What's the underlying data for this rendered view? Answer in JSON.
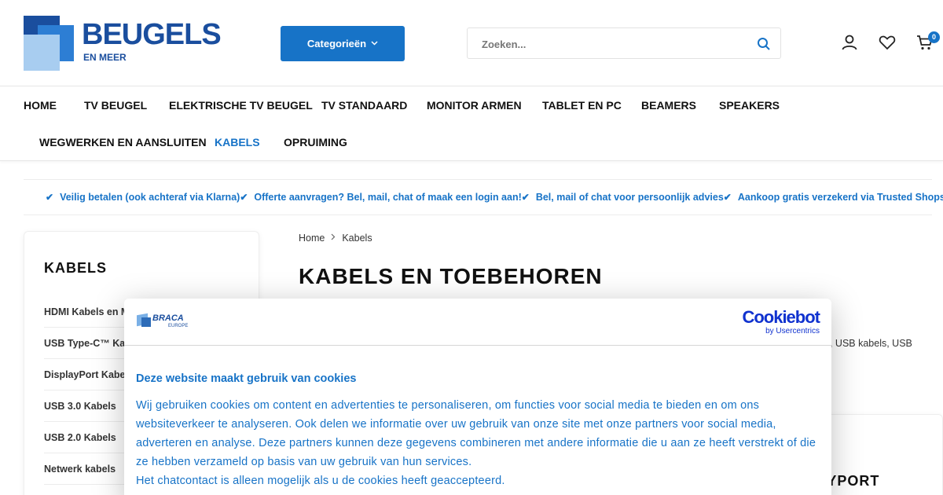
{
  "header": {
    "logo_main": "BEUGELS",
    "logo_sub": "EN MEER",
    "categories_label": "Categorieën",
    "search_placeholder": "Zoeken...",
    "cart_count": "0",
    "icons": [
      "search-icon",
      "user-icon",
      "heart-icon",
      "cart-icon"
    ]
  },
  "nav": {
    "row1": [
      "HOME",
      "TV BEUGEL",
      "ELEKTRISCHE TV BEUGEL",
      "TV STANDAARD",
      "MONITOR ARMEN",
      "TABLET EN PC",
      "BEAMERS",
      "SPEAKERS"
    ],
    "row2": [
      "WEGWERKEN EN AANSLUITEN",
      "KABELS",
      "OPRUIMING"
    ],
    "active": "KABELS"
  },
  "usps": [
    "Veilig betalen (ook achteraf via Klarna)",
    "Offerte aanvragen? Bel, mail, chat of maak een login aan!",
    "Bel, mail of chat voor persoonlijk advies",
    "Aankoop gratis verzekerd via Trusted Shops!"
  ],
  "sidebar": {
    "title": "KABELS",
    "items": [
      "HDMI Kabels en M",
      "USB Type-C™ Kab",
      "DisplayPort Kabe",
      "USB 3.0 Kabels",
      "USB 2.0 Kabels",
      "Netwerk kabels"
    ]
  },
  "main": {
    "breadcrumb": [
      "Home",
      "Kabels"
    ],
    "title": "KABELS EN TOEBEHOREN",
    "description_fragment": "els, USB kabels, USB",
    "promo_fragment": "AYPORT"
  },
  "cookie": {
    "brand": "BRACA",
    "brand_sub": "EUROPE",
    "provider": "Cookiebot",
    "provider_sub": "by Usercentrics",
    "title": "Deze website maakt gebruik van cookies",
    "body": "Wij gebruiken cookies om content en advertenties te personaliseren, om functies voor social media te bieden en om ons websiteverkeer te analyseren. Ook delen we informatie over uw gebruik van onze site met onze partners voor social media, adverteren en analyse. Deze partners kunnen deze gegevens combineren met andere informatie die u aan ze heeft verstrekt of die ze hebben verzameld op basis van uw gebruik van hun services.",
    "chat_note": "Het chatcontact is alleen mogelijk als u de cookies heeft geaccepteerd."
  },
  "colors": {
    "brand_blue": "#1773c7",
    "logo_blue": "#1a4e9e",
    "cookiebot_blue": "#1032cf"
  }
}
